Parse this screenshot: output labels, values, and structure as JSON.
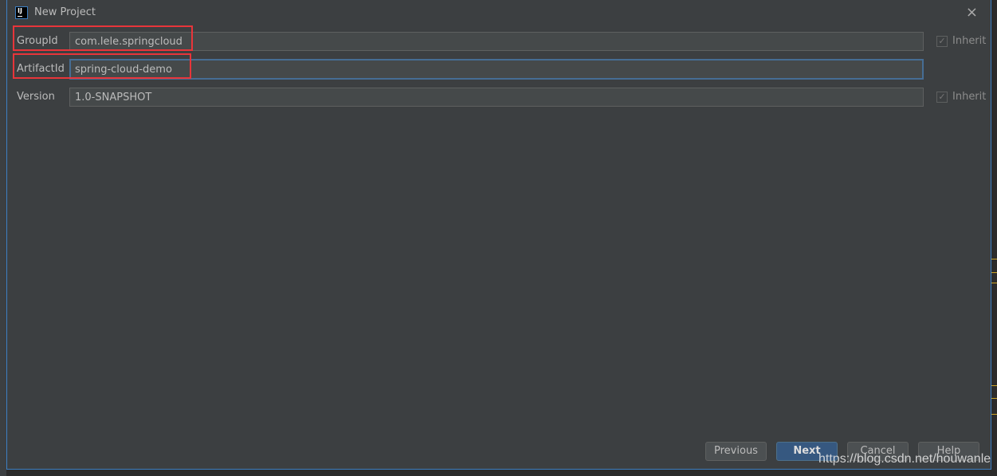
{
  "dialog": {
    "title": "New Project",
    "app_icon": "intellij-icon",
    "close": "×"
  },
  "fields": [
    {
      "label": "GroupId",
      "value": "com.lele.springcloud",
      "inherit": true
    },
    {
      "label": "ArtifactId",
      "value": "spring-cloud-demo"
    },
    {
      "label": "Version",
      "value": "1.0-SNAPSHOT",
      "inherit": true
    }
  ],
  "inherit_label": "Inherit",
  "buttons": {
    "previous": "Previous",
    "next": "Next",
    "cancel": "Cancel",
    "help": "Help"
  },
  "watermark": "https://blog.csdn.net/houwanle",
  "colors": {
    "accent": "#365880",
    "highlight": "#e8353a",
    "focus": "#466d94"
  }
}
